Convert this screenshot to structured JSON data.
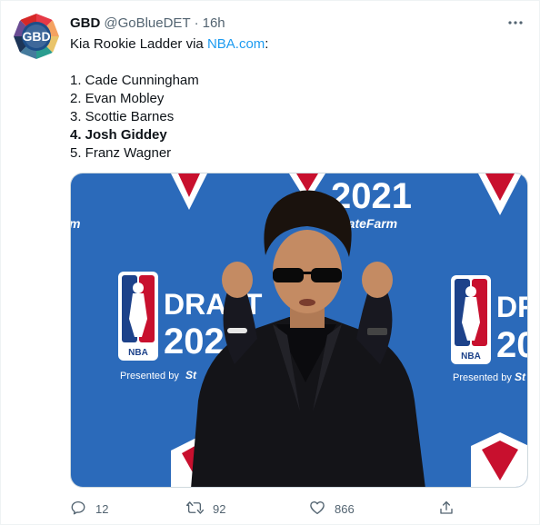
{
  "tweet": {
    "display_name": "GBD",
    "handle": "@GoBlueDET",
    "separator": "·",
    "time": "16h",
    "avatar_text": "GBD",
    "text_prefix": "Kia Rookie Ladder via ",
    "link_text": "NBA.com",
    "text_suffix": ":",
    "ladder": [
      "1. Cade Cunningham",
      "2. Evan Mobley",
      "3. Scottie Barnes",
      "4. Josh Giddey",
      "5. Franz Wagner"
    ],
    "highlighted_index": 3
  },
  "media": {
    "backdrop_year": "2021",
    "backdrop_draft_left": "DRAFT",
    "backdrop_year_left": "202",
    "backdrop_draft_right": "DR",
    "backdrop_year_right": "20",
    "backdrop_logo_text": "NBA",
    "backdrop_presented": "Presented by",
    "backdrop_sponsor": "tateFarm",
    "backdrop_sponsor_short": "St",
    "backdrop_edge_text": "m",
    "colors": {
      "backdrop": "#2f6fc0",
      "suit": "#141418"
    }
  },
  "actions": {
    "reply_count": "12",
    "retweet_count": "92",
    "like_count": "866"
  },
  "icons": {
    "reply": "reply-icon",
    "retweet": "retweet-icon",
    "like": "heart-icon",
    "share": "share-icon",
    "more": "more-icon"
  },
  "colors": {
    "link": "#1d9bf0",
    "secondary_text": "#536471"
  }
}
